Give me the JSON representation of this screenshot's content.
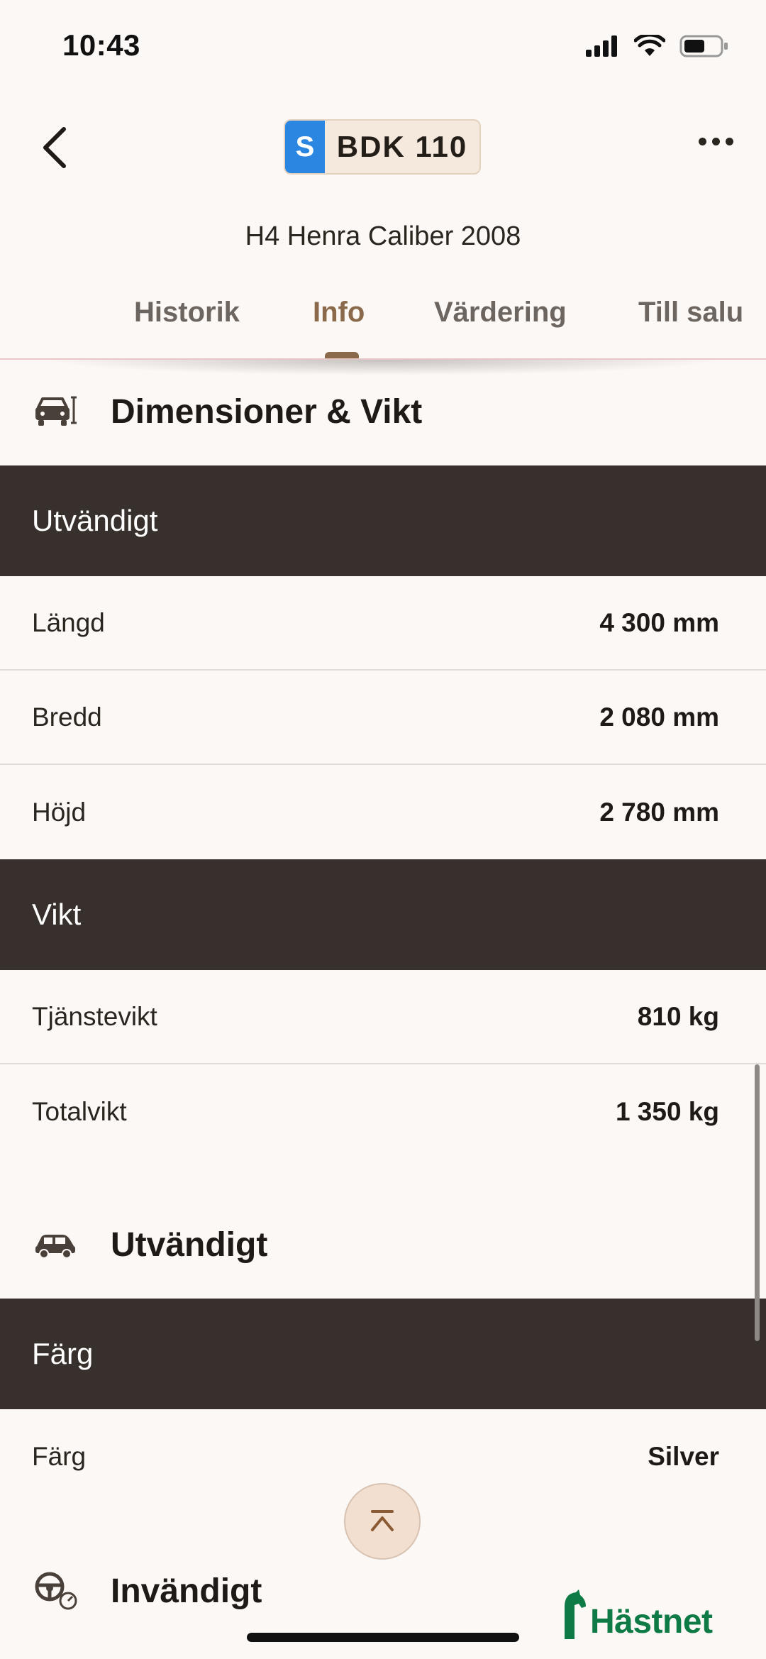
{
  "status_bar": {
    "time": "10:43"
  },
  "header": {
    "plate_country": "S",
    "plate_number": "BDK 110",
    "vehicle_title": "H4 Henra Caliber 2008"
  },
  "tabs": [
    {
      "label": "Historik",
      "active": false
    },
    {
      "label": "Info",
      "active": true
    },
    {
      "label": "Värdering",
      "active": false
    },
    {
      "label": "Till salu",
      "active": false
    }
  ],
  "sections": {
    "dimensions": {
      "title": "Dimensioner & Vikt",
      "icon": "car-dimensions-icon",
      "groups": {
        "exterior": {
          "title": "Utvändigt",
          "rows": [
            {
              "label": "Längd",
              "value": "4 300 mm"
            },
            {
              "label": "Bredd",
              "value": "2 080 mm"
            },
            {
              "label": "Höjd",
              "value": "2 780 mm"
            }
          ]
        },
        "weight": {
          "title": "Vikt",
          "rows": [
            {
              "label": "Tjänstevikt",
              "value": "810 kg"
            },
            {
              "label": "Totalvikt",
              "value": "1 350 kg"
            }
          ]
        }
      }
    },
    "exterior": {
      "title": "Utvändigt",
      "icon": "car-exterior-icon",
      "groups": {
        "color": {
          "title": "Färg",
          "rows": [
            {
              "label": "Färg",
              "value": "Silver"
            }
          ]
        }
      }
    },
    "interior": {
      "title": "Invändigt",
      "icon": "steering-wheel-icon"
    }
  },
  "logo": {
    "text": "Hästnet"
  },
  "colors": {
    "background": "#fcf8f5",
    "group_bar": "#38302c",
    "accent": "#8a6a4a",
    "plate_blue": "#2a86e0",
    "logo_green": "#0e7a45"
  }
}
